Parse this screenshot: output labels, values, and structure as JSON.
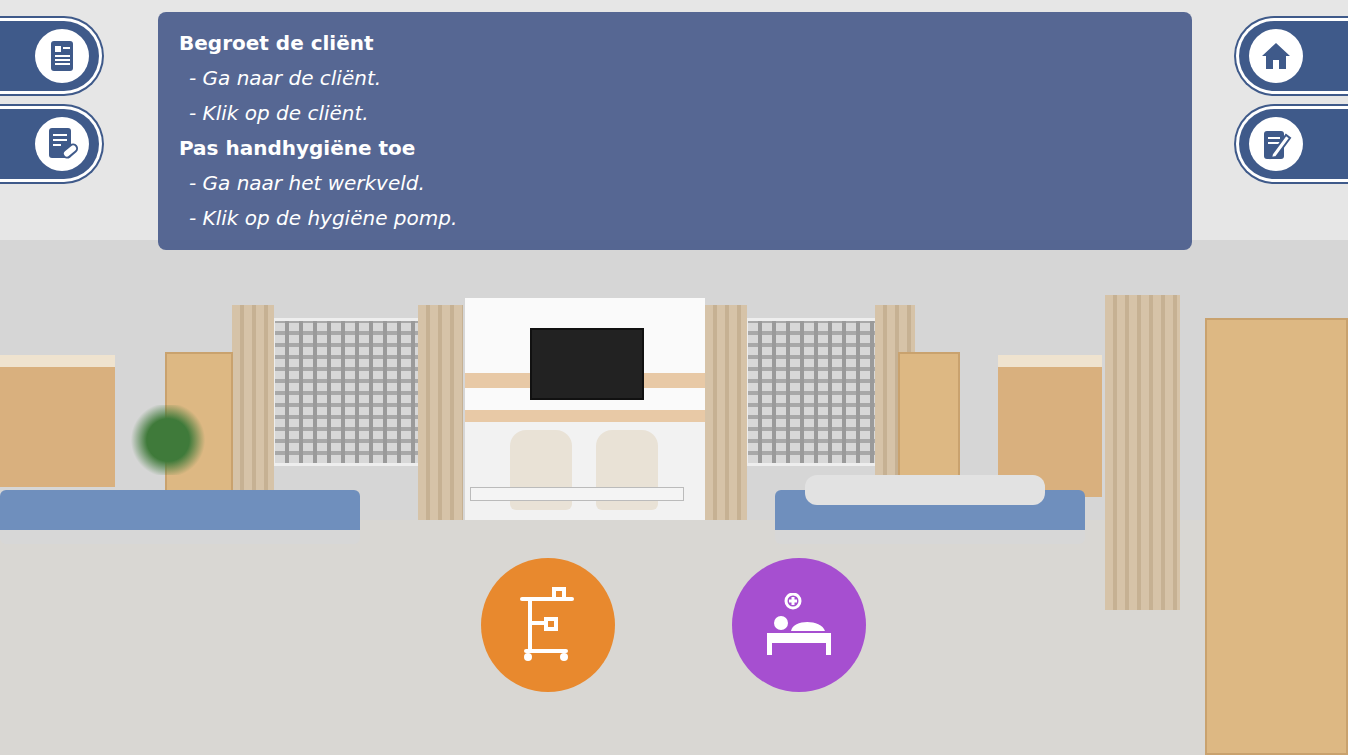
{
  "instructions": [
    {
      "title": "Begroet de cliënt",
      "steps": [
        "- Ga naar de cliënt.",
        "- Klik op de cliënt."
      ]
    },
    {
      "title": "Pas handhygiëne toe",
      "steps": [
        "- Ga naar het werkveld.",
        "- Klik op de hygiëne pomp."
      ]
    }
  ],
  "hotspots": [
    {
      "kind": "trolley",
      "color": "#e8892e"
    },
    {
      "kind": "patient",
      "color": "#a64fd0"
    }
  ]
}
